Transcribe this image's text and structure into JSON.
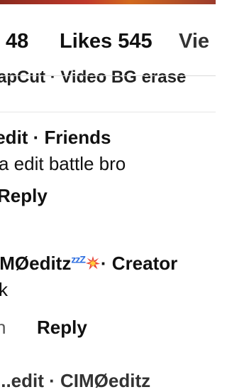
{
  "tabs": {
    "comments_count": "48",
    "likes_label": "Likes 545",
    "views_label": "Vie"
  },
  "banner_text": "apCut · Video BG erase",
  "comments": [
    {
      "header": ".edit · Friends",
      "body": "a edit battle bro",
      "reply_label": "Reply"
    },
    {
      "name": "IMØeditz",
      "zz": "zzZ",
      "emoji": "collision-emoji",
      "role": "· Creator",
      "body": "k",
      "time": "h",
      "reply_label": "Reply"
    },
    {
      "header": "...edit · CIMØeditz"
    }
  ]
}
